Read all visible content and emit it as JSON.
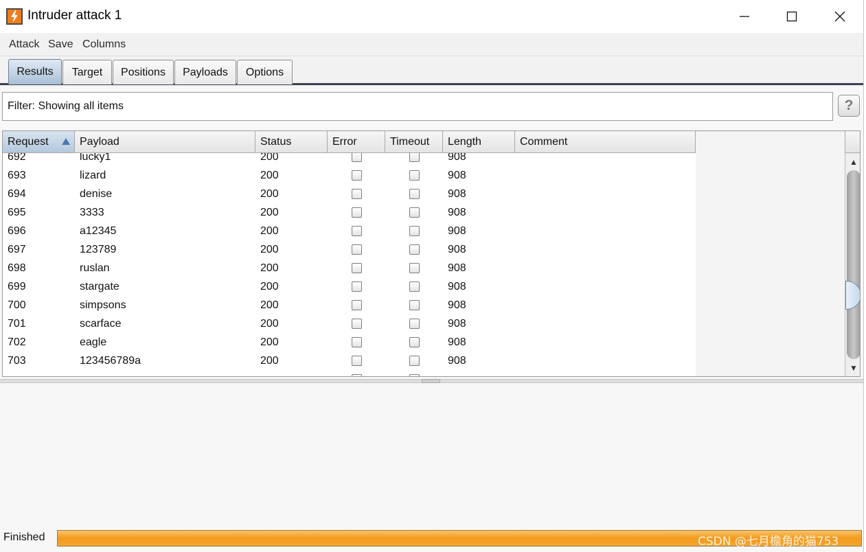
{
  "window": {
    "title": "Intruder attack 1",
    "controls": {
      "minimize": "─",
      "maximize": "☐",
      "close": "✕"
    }
  },
  "menu": {
    "items": [
      {
        "label": "Attack"
      },
      {
        "label": "Save"
      },
      {
        "label": "Columns"
      }
    ]
  },
  "tabs": {
    "items": [
      {
        "label": "Results",
        "active": true
      },
      {
        "label": "Target",
        "active": false
      },
      {
        "label": "Positions",
        "active": false
      },
      {
        "label": "Payloads",
        "active": false
      },
      {
        "label": "Options",
        "active": false
      }
    ]
  },
  "filter": {
    "text": "Filter:  Showing all items",
    "help_label": "?"
  },
  "table": {
    "columns": [
      {
        "label": "Request",
        "sorted": "ascending"
      },
      {
        "label": "Payload"
      },
      {
        "label": "Status"
      },
      {
        "label": "Error"
      },
      {
        "label": "Timeout"
      },
      {
        "label": "Length"
      },
      {
        "label": "Comment"
      }
    ],
    "rows": [
      {
        "request": "692",
        "payload": "lucky1",
        "status": "200",
        "error": false,
        "timeout": false,
        "length": "908",
        "comment": ""
      },
      {
        "request": "693",
        "payload": "lizard",
        "status": "200",
        "error": false,
        "timeout": false,
        "length": "908",
        "comment": ""
      },
      {
        "request": "694",
        "payload": "denise",
        "status": "200",
        "error": false,
        "timeout": false,
        "length": "908",
        "comment": ""
      },
      {
        "request": "695",
        "payload": "3333",
        "status": "200",
        "error": false,
        "timeout": false,
        "length": "908",
        "comment": ""
      },
      {
        "request": "696",
        "payload": "a12345",
        "status": "200",
        "error": false,
        "timeout": false,
        "length": "908",
        "comment": ""
      },
      {
        "request": "697",
        "payload": "123789",
        "status": "200",
        "error": false,
        "timeout": false,
        "length": "908",
        "comment": ""
      },
      {
        "request": "698",
        "payload": "ruslan",
        "status": "200",
        "error": false,
        "timeout": false,
        "length": "908",
        "comment": ""
      },
      {
        "request": "699",
        "payload": "stargate",
        "status": "200",
        "error": false,
        "timeout": false,
        "length": "908",
        "comment": ""
      },
      {
        "request": "700",
        "payload": "simpsons",
        "status": "200",
        "error": false,
        "timeout": false,
        "length": "908",
        "comment": ""
      },
      {
        "request": "701",
        "payload": "scarface",
        "status": "200",
        "error": false,
        "timeout": false,
        "length": "908",
        "comment": ""
      },
      {
        "request": "702",
        "payload": "eagle",
        "status": "200",
        "error": false,
        "timeout": false,
        "length": "908",
        "comment": ""
      },
      {
        "request": "703",
        "payload": "123456789a",
        "status": "200",
        "error": false,
        "timeout": false,
        "length": "908",
        "comment": ""
      }
    ],
    "scroll": {
      "up": "▲",
      "down": "▼"
    }
  },
  "status_bar": {
    "text": "Finished",
    "progress_percent": 100,
    "watermark": "CSDN @七月檐角的猫753"
  },
  "colors": {
    "progress": "#f29a1c",
    "selected_tab": "#a9bfd6",
    "sort_arrow": "#4a77b0",
    "logo_orange": "#f07d1c",
    "logo_dark": "#4a4a4a"
  }
}
